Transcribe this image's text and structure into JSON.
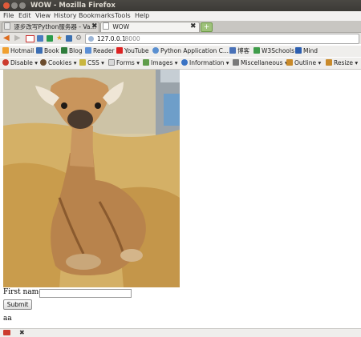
{
  "window": {
    "title": "WOW - Mozilla Firefox"
  },
  "menu": [
    "File",
    "Edit",
    "View",
    "History",
    "Bookmarks",
    "Tools",
    "Help"
  ],
  "tabs": [
    {
      "label": "逐步改写Python服务器 - Va..."
    },
    {
      "label": "WOW"
    }
  ],
  "address": {
    "url": "127.0.0.1",
    "port": ":8000"
  },
  "bookmarks": [
    "Hotmail",
    "Book",
    "Blog",
    "Reader",
    "YouTube",
    "Python Application C...",
    "博客",
    "W3Schools",
    "Mind"
  ],
  "webdev": [
    "Disable",
    "Cookies",
    "CSS",
    "Forms",
    "Images",
    "Information",
    "Miscellaneous",
    "Outline",
    "Resize"
  ],
  "page": {
    "image_subject": "baby giraffe",
    "first_name_label": "First name:",
    "first_name_value": "",
    "submit_label": "Submit",
    "output_text": "aa"
  },
  "colors": {
    "titlebar": "#3c3b37",
    "close_button": "#e05a3a",
    "accent": "#dd4814"
  }
}
